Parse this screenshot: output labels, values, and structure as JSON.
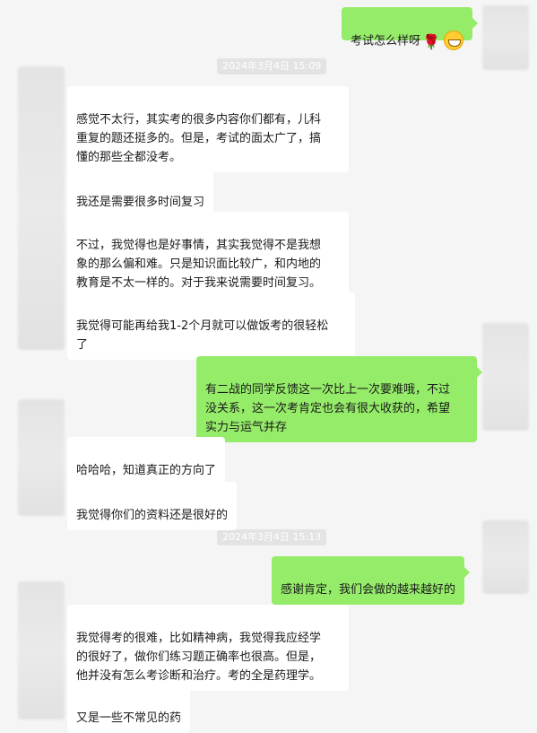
{
  "conversation": {
    "timestamps": [
      "2024年3月4日 15:09",
      "2024年3月4日 15:13"
    ],
    "messages": [
      {
        "side": "out",
        "text": "考试怎么样呀"
      },
      {
        "side": "in",
        "text": "感觉不太行，其实考的很多内容你们都有，儿科\n重复的题还挺多的。但是，考试的面太广了，搞\n懂的那些全都没考。"
      },
      {
        "side": "in",
        "text": "我还是需要很多时间复习"
      },
      {
        "side": "in",
        "text": "不过，我觉得也是好事情，其实我觉得不是我想\n象的那么偏和难。只是知识面比较广，和内地的\n教育是不太一样的。对于我来说需要时间复习。"
      },
      {
        "side": "in",
        "text": "我觉得可能再给我1-2个月就可以做饭考的很轻松\n了"
      },
      {
        "side": "out",
        "text": "有二战的同学反馈这一次比上一次要难哦，不过\n没关系，这一次考肯定也会有很大收获的，希望\n实力与运气并存"
      },
      {
        "side": "in",
        "text": "哈哈哈，知道真正的方向了"
      },
      {
        "side": "in",
        "text": "我觉得你们的资料还是很好的"
      },
      {
        "side": "out",
        "text": "感谢肯定，我们会做的越来越好的"
      },
      {
        "side": "in",
        "text": "我觉得考的很难，比如精神病，我觉得我应经学\n的很好了，做你们练习题正确率也很高。但是，\n他并没有怎么考诊断和治疗。考的全是药理学。"
      },
      {
        "side": "in",
        "text": "又是一些不常见的药"
      }
    ]
  }
}
